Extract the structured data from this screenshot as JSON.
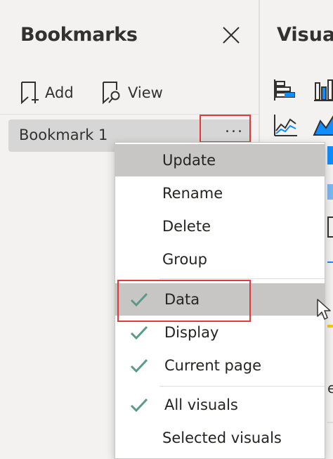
{
  "bookmarks_pane": {
    "title": "Bookmarks",
    "toolbar": {
      "add_label": "Add",
      "view_label": "View"
    },
    "bookmarks": [
      {
        "label": "Bookmark 1"
      }
    ],
    "more_label": "..."
  },
  "context_menu": {
    "items": [
      {
        "label": "Update",
        "checked": false
      },
      {
        "label": "Rename",
        "checked": false
      },
      {
        "label": "Delete",
        "checked": false
      },
      {
        "label": "Group",
        "checked": false
      },
      {
        "label": "Data",
        "checked": true
      },
      {
        "label": "Display",
        "checked": true
      },
      {
        "label": "Current page",
        "checked": true
      },
      {
        "label": "All visuals",
        "checked": true
      },
      {
        "label": "Selected visuals",
        "checked": false
      }
    ]
  },
  "visuals_pane": {
    "title": "Visualizations",
    "peek_letter": "e"
  },
  "colors": {
    "check": "#5b9a8b",
    "highlight_box": "#e03a3a",
    "accent_blue": "#118dff"
  }
}
